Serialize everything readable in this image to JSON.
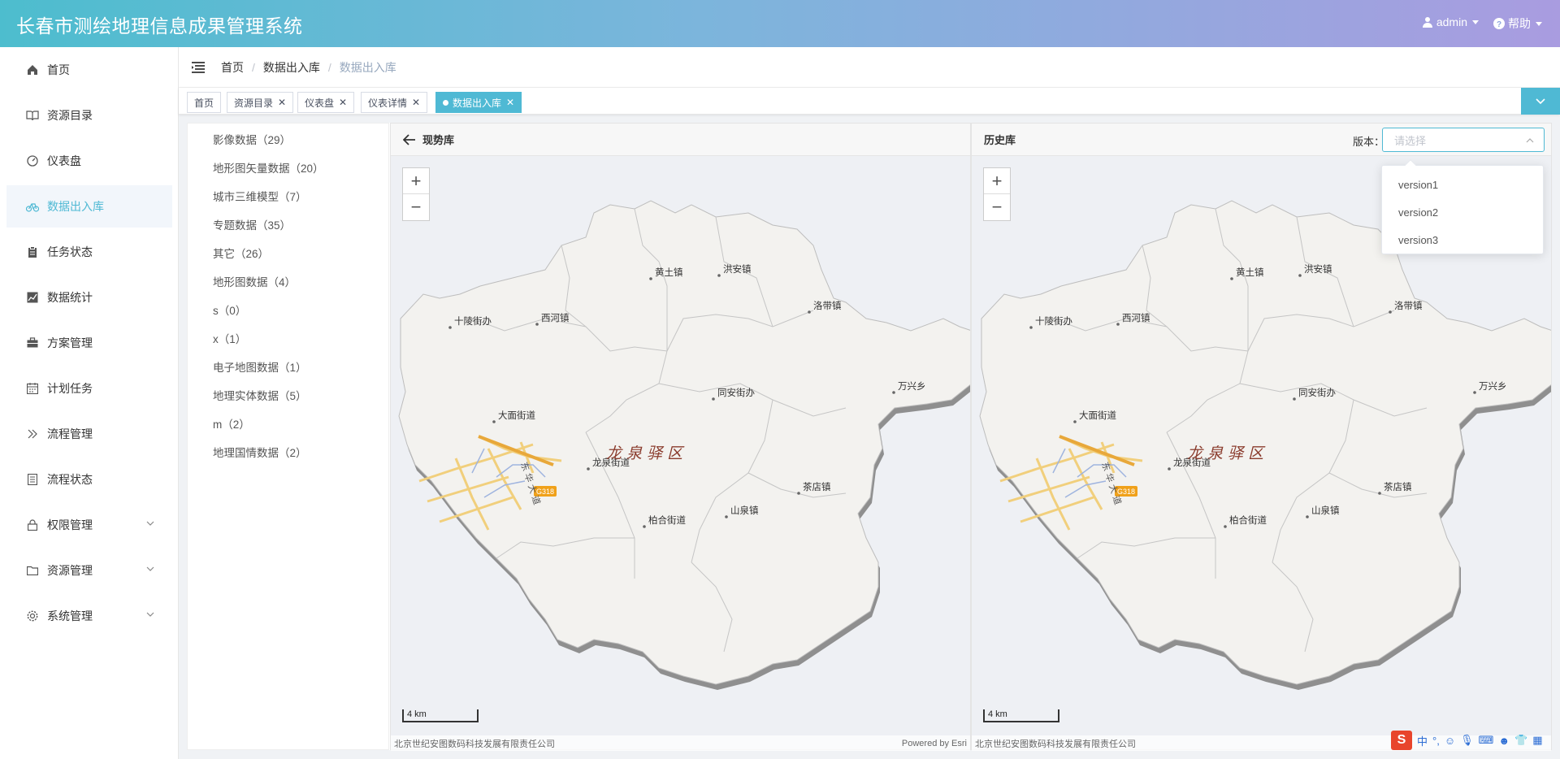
{
  "header": {
    "title": "长春市测绘地理信息成果管理系统",
    "user": "admin",
    "help": "帮助"
  },
  "sidebar": {
    "items": [
      {
        "label": "首页",
        "icon": "home-icon"
      },
      {
        "label": "资源目录",
        "icon": "book-icon"
      },
      {
        "label": "仪表盘",
        "icon": "dashboard-icon"
      },
      {
        "label": "数据出入库",
        "icon": "bicycle-icon",
        "active": true
      },
      {
        "label": "任务状态",
        "icon": "clipboard-icon"
      },
      {
        "label": "数据统计",
        "icon": "chart-icon"
      },
      {
        "label": "方案管理",
        "icon": "briefcase-icon"
      },
      {
        "label": "计划任务",
        "icon": "calendar-icon"
      },
      {
        "label": "流程管理",
        "icon": "double-chevron-icon"
      },
      {
        "label": "流程状态",
        "icon": "document-icon"
      },
      {
        "label": "权限管理",
        "icon": "lock-icon"
      },
      {
        "label": "资源管理",
        "icon": "folder-icon"
      },
      {
        "label": "系统管理",
        "icon": "settings-icon"
      }
    ]
  },
  "breadcrumb": {
    "home": "首页",
    "parent": "数据出入库",
    "current": "数据出入库"
  },
  "tags": [
    {
      "label": "首页"
    },
    {
      "label": "资源目录"
    },
    {
      "label": "仪表盘"
    },
    {
      "label": "仪表详情"
    },
    {
      "label": "数据出入库"
    }
  ],
  "tree": {
    "items": [
      "影像数据（29）",
      "地形图矢量数据（20）",
      "城市三维模型（7）",
      "专题数据（35）",
      "其它（26）",
      "地形图数据（4）",
      "s（0）",
      "x（1）",
      "电子地图数据（1）",
      "地理实体数据（5）",
      "m（2）",
      "地理国情数据（2）"
    ]
  },
  "left_panel": {
    "title": "现势库"
  },
  "right_panel": {
    "title": "历史库",
    "version_label": "版本：",
    "version_placeholder": "请选择"
  },
  "dropdown": {
    "options": [
      "version1",
      "version2",
      "version3"
    ]
  },
  "map": {
    "district": "龙 泉 驿 区",
    "places": [
      "黄土镇",
      "洪安镇",
      "十陵街办",
      "西河镇",
      "洛带镇",
      "万兴乡",
      "同安街办",
      "大面街道",
      "龙泉街道",
      "茶店镇",
      "山泉镇",
      "柏合街道"
    ],
    "road": "G318",
    "road2": "东 华 大 道",
    "scale": "4 km",
    "attribution": "北京世纪安图数码科技发展有限责任公司",
    "powered": "Powered by Esri"
  },
  "ime": {
    "logo": "S",
    "mode": "中"
  },
  "colors": {
    "accent": "#4fb9d4",
    "header_start": "#4dbdce",
    "header_end": "#a99ce0"
  }
}
